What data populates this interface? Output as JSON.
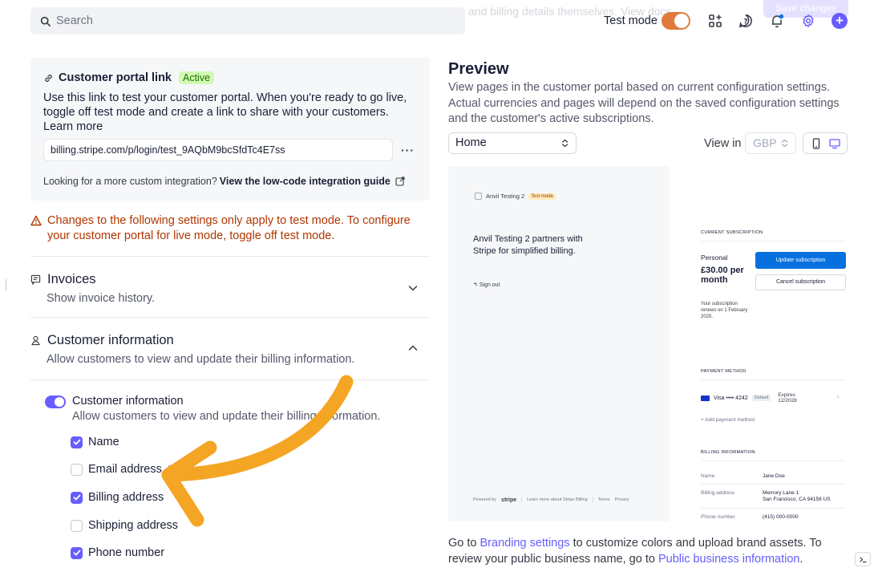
{
  "topbar": {
    "search_placeholder": "Search",
    "ghost_text": "and billing details themselves. View docs",
    "ghost_button": "Save changes",
    "test_mode_label": "Test mode",
    "test_mode_on": true,
    "icons": [
      "apps-icon",
      "help-icon",
      "bell-icon",
      "gear-icon",
      "plus-icon"
    ]
  },
  "portal": {
    "title": "Customer portal link",
    "badge": "Active",
    "description": "Use this link to test your customer portal. When you're ready to go live, toggle off test mode and create a link to share with your customers.",
    "learn_more": "Learn more",
    "link": "billing.stripe.com/p/login/test_9AQbM9bcSfdTc4E7ss",
    "more": "···",
    "footer_prefix": "Looking for a more custom integration?",
    "footer_link": "View the low-code integration guide"
  },
  "warning": "Changes to the following settings only apply to test mode. To configure your customer portal for live mode, toggle off test mode.",
  "sections": {
    "invoices": {
      "title": "Invoices",
      "subtitle": "Show invoice history."
    },
    "customer_info": {
      "title": "Customer information",
      "subtitle": "Allow customers to view and update their billing information."
    }
  },
  "customer_info_toggle": {
    "title": "Customer information",
    "subtitle": "Allow customers to view and update their billing information.",
    "enabled": true
  },
  "fields": [
    {
      "label": "Name",
      "checked": true
    },
    {
      "label": "Email address",
      "checked": false
    },
    {
      "label": "Billing address",
      "checked": true
    },
    {
      "label": "Shipping address",
      "checked": false
    },
    {
      "label": "Phone number",
      "checked": true
    }
  ],
  "preview": {
    "title": "Preview",
    "description": "View pages in the customer portal based on current configuration settings. Actual currencies and pages will depend on the saved configuration settings and the customer's active subscriptions.",
    "page_select": "Home",
    "view_in_label": "View in",
    "currency": "GBP",
    "footer_prefix": "Go to",
    "branding_link": "Branding settings",
    "footer_middle": "to customize colors and upload brand assets. To review your public business name, go to",
    "public_info_link": "Public business information",
    "footer_end": "."
  },
  "mock": {
    "business": "Anvil Testing 2",
    "test_badge": "Test mode",
    "headline": "Anvil Testing 2 partners with Stripe for simplified billing.",
    "sign_out": "Sign out",
    "powered_by": "Powered by",
    "stripe": "stripe",
    "learn_more": "Learn more about Stripe Billing",
    "terms": "Terms",
    "privacy": "Privacy",
    "current_subscription_label": "CURRENT SUBSCRIPTION",
    "plan": "Personal",
    "price": "£30.00 per month",
    "renews": "Your subscription renews on 1 February 2025.",
    "update_btn": "Update subscription",
    "cancel_btn": "Cancel subscription",
    "payment_method_label": "PAYMENT METHOD",
    "card": "Visa •••• 4242",
    "default_badge": "Default",
    "expires": "Expires 12/2028",
    "remove": "×",
    "add_payment": "+ Add payment method",
    "billing_info_label": "BILLING INFORMATION",
    "name_key": "Name",
    "name_val": "Jane Doe",
    "address_key": "Billing address",
    "address_line1": "Memory Lane 1",
    "address_line2": "San Francisco, CA 94158 US",
    "phone_key": "Phone number",
    "phone_val": "(415) 000-0000"
  },
  "colors": {
    "accent": "#675dff",
    "test_mode": "#e07a3c",
    "warning": "#b13600",
    "active_badge_bg": "#d1fab3",
    "annotation_arrow": "#f5a524"
  }
}
